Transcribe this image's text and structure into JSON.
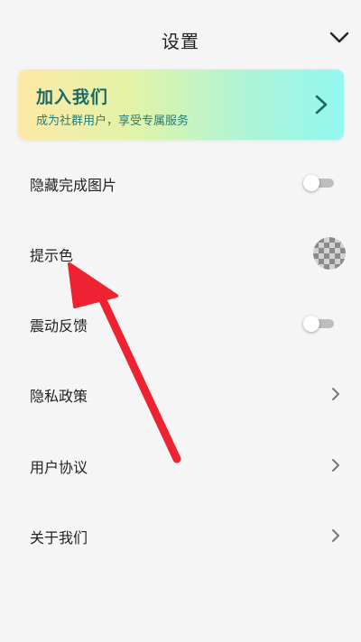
{
  "header": {
    "title": "设置",
    "collapse_icon": "chevron-down-icon"
  },
  "banner": {
    "title": "加入我们",
    "subtitle": "成为社群用户，享受专属服务",
    "icon": "chevron-right-icon",
    "gradient": [
      "#fde9a6",
      "#92f8f1"
    ],
    "title_color": "#1c6a63"
  },
  "settings": {
    "hide_completed_images": {
      "label": "隐藏完成图片",
      "enabled": false
    },
    "hint_color": {
      "label": "提示色",
      "value_icon": "checkerboard-swatch"
    },
    "vibration_feedback": {
      "label": "震动反馈",
      "enabled": false
    },
    "privacy_policy": {
      "label": "隐私政策",
      "icon": "chevron-right-icon"
    },
    "user_agreement": {
      "label": "用户协议",
      "icon": "chevron-right-icon"
    },
    "about_us": {
      "label": "关于我们",
      "icon": "chevron-right-icon"
    }
  },
  "annotation": {
    "arrow_color": "#ee2230",
    "points_to": "提示色"
  }
}
